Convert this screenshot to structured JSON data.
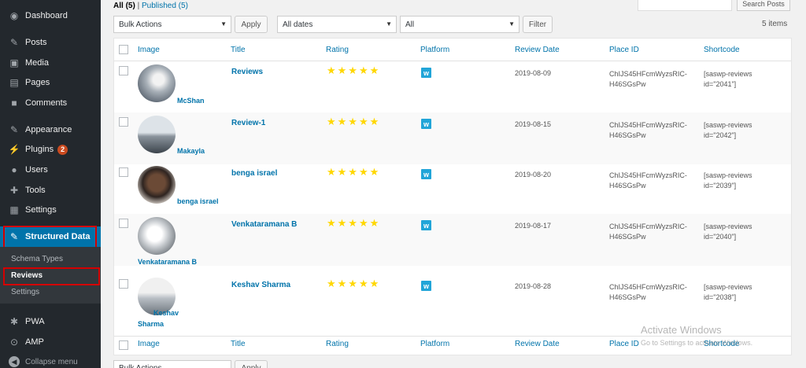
{
  "sidebar": {
    "items": [
      {
        "label": "Dashboard",
        "icon": "dashboard-icon",
        "glyph": "◉"
      },
      {
        "label": "Posts",
        "icon": "pin-icon",
        "glyph": "✎"
      },
      {
        "label": "Media",
        "icon": "media-icon",
        "glyph": "▣"
      },
      {
        "label": "Pages",
        "icon": "pages-icon",
        "glyph": "▤"
      },
      {
        "label": "Comments",
        "icon": "comments-icon",
        "glyph": "■"
      },
      {
        "label": "Appearance",
        "icon": "appearance-icon",
        "glyph": "✎"
      },
      {
        "label": "Plugins",
        "icon": "plugins-icon",
        "glyph": "⚡",
        "badge": "2"
      },
      {
        "label": "Users",
        "icon": "users-icon",
        "glyph": "●"
      },
      {
        "label": "Tools",
        "icon": "tools-icon",
        "glyph": "✚"
      },
      {
        "label": "Settings",
        "icon": "settings-icon",
        "glyph": "▦"
      },
      {
        "label": "Structured Data",
        "icon": "pin-icon",
        "glyph": "✎"
      },
      {
        "label": "PWA",
        "icon": "gear-icon",
        "glyph": "✱"
      },
      {
        "label": "AMP",
        "icon": "amp-icon",
        "glyph": "⊙"
      }
    ],
    "submenu": [
      "Schema Types",
      "Reviews",
      "Settings"
    ],
    "collapse_label": "Collapse menu"
  },
  "filters": {
    "all_label": "All",
    "all_count": "(5)",
    "separator": "|",
    "published_label": "Published",
    "published_count": "(5)",
    "bulk_actions": "Bulk Actions",
    "apply_label": "Apply",
    "dates": "All dates",
    "platform": "All",
    "filter_label": "Filter",
    "items_count": "5 items",
    "search_button": "Search Posts"
  },
  "table": {
    "columns": [
      "Image",
      "Title",
      "Rating",
      "Platform",
      "Review Date",
      "Place ID",
      "Shortcode"
    ],
    "rows": [
      {
        "author": "McShan",
        "title": "Reviews",
        "stars": "★★★★★",
        "platform_glyph": "w",
        "date": "2019-08-09",
        "place_id_1": "ChIJS45HFcmWyzsRIC-",
        "place_id_2": "H46SGsPw",
        "shortcode_1": "[saswp-reviews",
        "shortcode_2": "id=\"2041\"]"
      },
      {
        "author": "Makayla",
        "title": "Review-1",
        "stars": "★★★★★",
        "platform_glyph": "w",
        "date": "2019-08-15",
        "place_id_1": "ChIJS45HFcmWyzsRIC-",
        "place_id_2": "H46SGsPw",
        "shortcode_1": "[saswp-reviews",
        "shortcode_2": "id=\"2042\"]"
      },
      {
        "author": "benga israel",
        "title": "benga israel",
        "stars": "★★★★★",
        "platform_glyph": "w",
        "date": "2019-08-20",
        "place_id_1": "ChIJS45HFcmWyzsRIC-",
        "place_id_2": "H46SGsPw",
        "shortcode_1": "[saswp-reviews",
        "shortcode_2": "id=\"2039\"]"
      },
      {
        "author": "Venkataramana B",
        "title": "Venkataramana B",
        "stars": "★★★★★",
        "platform_glyph": "w",
        "date": "2019-08-17",
        "place_id_1": "ChIJS45HFcmWyzsRIC-",
        "place_id_2": "H46SGsPw",
        "shortcode_1": "[saswp-reviews",
        "shortcode_2": "id=\"2040\"]"
      },
      {
        "author_line1": "Keshav",
        "author_line2": "Sharma",
        "title": "Keshav Sharma",
        "stars": "★★★★★",
        "platform_glyph": "w",
        "date": "2019-08-28",
        "place_id_1": "ChIJS45HFcmWyzsRIC-",
        "place_id_2": "H46SGsPw",
        "shortcode_1": "[saswp-reviews",
        "shortcode_2": "id=\"2038\"]"
      }
    ]
  },
  "watermark": {
    "title": "Activate Windows",
    "subtitle": "Go to Settings to activate Windows."
  },
  "bottom": {
    "bulk_actions": "Bulk Actions",
    "apply_label": "Apply"
  },
  "colors": {
    "sidebar_bg": "#23282d",
    "accent": "#0073aa",
    "highlight": "#d50000",
    "star": "#ffd700",
    "platform": "#21a5d8"
  }
}
